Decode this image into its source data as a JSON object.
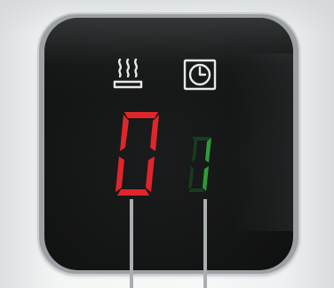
{
  "display": {
    "primary_digit": "0",
    "secondary_digit": "1"
  },
  "icons": {
    "heat": "heat-icon",
    "timer": "clock-icon"
  },
  "colors": {
    "panel": "#141515",
    "primary_digit": "#e0262b",
    "secondary_digit": "#2e9b3a",
    "icon": "#e8e8e8",
    "housing": "#f4f6f6"
  }
}
